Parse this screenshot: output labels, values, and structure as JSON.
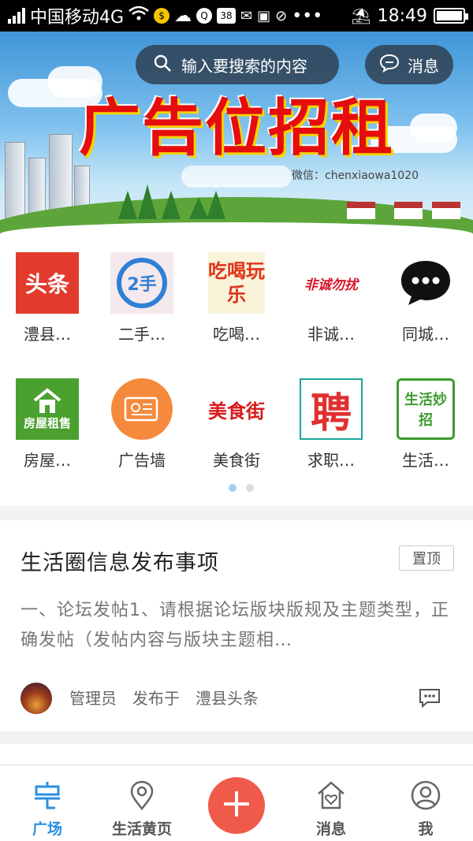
{
  "statusbar": {
    "carrier": "中国移动4G",
    "time": "18:49",
    "notif_count": "38"
  },
  "banner": {
    "ad_title": "广告位招租",
    "ad_wechat": "微信：chenxiaowa1020"
  },
  "search": {
    "placeholder": "输入要搜索的内容"
  },
  "header": {
    "message_label": "消息"
  },
  "grid": [
    {
      "label": "澧县…",
      "icon": "toutiao-icon",
      "icon_text": "头条",
      "color": "#e23b2e"
    },
    {
      "label": "二手…",
      "icon": "secondhand-icon",
      "icon_text": "2手",
      "color": "#2f7fd6"
    },
    {
      "label": "吃喝…",
      "icon": "food-fun-icon",
      "icon_text": "吃喝玩乐",
      "color": "#e0331c"
    },
    {
      "label": "非诚…",
      "icon": "dating-icon",
      "icon_text": "非诚勿扰",
      "color": "#d8152a"
    },
    {
      "label": "同城…",
      "icon": "chat-bubble-icon",
      "icon_text": "",
      "color": "#111111"
    },
    {
      "label": "房屋…",
      "icon": "house-rent-icon",
      "icon_text": "房屋租售",
      "color": "#4aa12f"
    },
    {
      "label": "广告墙",
      "icon": "ad-wall-icon",
      "icon_text": "",
      "color": "#f58a3d"
    },
    {
      "label": "美食街",
      "icon": "food-street-icon",
      "icon_text": "美食街",
      "color": "#d61b1b"
    },
    {
      "label": "求职…",
      "icon": "recruit-icon",
      "icon_text": "聘",
      "color": "#e23030"
    },
    {
      "label": "生活…",
      "icon": "life-tips-icon",
      "icon_text": "生活妙招",
      "color": "#3d9b2f"
    }
  ],
  "post": {
    "title": "生活圈信息发布事项",
    "pin_label": "置顶",
    "body": "一、论坛发帖1、请根据论坛版块版规及主题类型，正确发帖（发帖内容与版块主题相…",
    "author": "管理员",
    "published_in": "发布于",
    "board": "澧县头条"
  },
  "tabbar": {
    "items": [
      {
        "label": "广场",
        "icon": "plaza-icon",
        "active": true
      },
      {
        "label": "生活黄页",
        "icon": "location-pin-icon",
        "active": false
      },
      {
        "label": "消息",
        "icon": "house-heart-icon",
        "active": false
      },
      {
        "label": "我",
        "icon": "user-icon",
        "active": false
      }
    ],
    "plus_icon": "plus-icon"
  },
  "colors": {
    "accent": "#2b8fe0",
    "plus": "#f05a4a"
  }
}
